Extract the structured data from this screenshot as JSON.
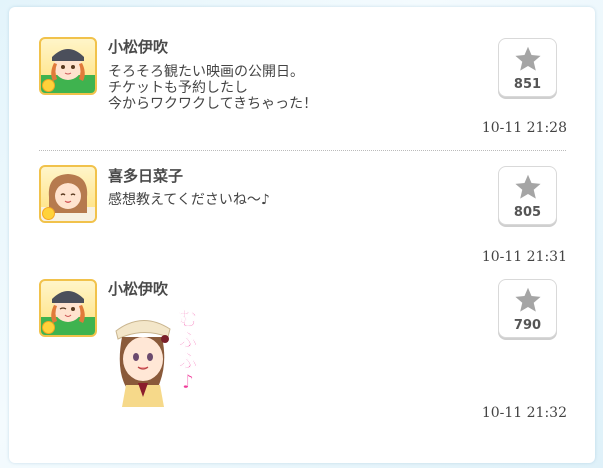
{
  "posts": [
    {
      "user": "小松伊吹",
      "message": "そろそろ観たい映画の公開日。\nチケットも予約したし\n今からワクワクしてきちゃった！",
      "likes": "851",
      "time": "10-11 21:28"
    },
    {
      "user": "喜多日菜子",
      "message": "感想教えてくださいね〜♪",
      "likes": "805",
      "time": "10-11 21:31"
    },
    {
      "user": "小松伊吹",
      "sticker_text": "むふふ♪",
      "likes": "790",
      "time": "10-11 21:32"
    }
  ],
  "colors": {
    "star": "#a5a5a5",
    "sticker_text": "#f03c9b",
    "avatar_border": "#f1c24b"
  }
}
